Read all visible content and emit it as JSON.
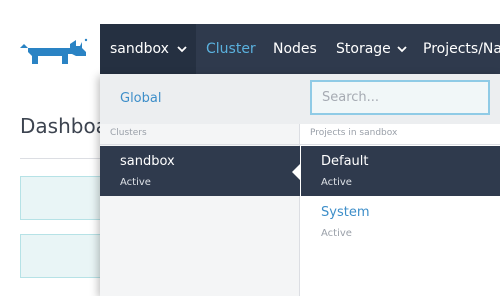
{
  "header": {
    "cluster_label": "sandbox",
    "nav": [
      {
        "label": "Cluster"
      },
      {
        "label": "Nodes"
      },
      {
        "label": "Storage"
      },
      {
        "label": "Projects/Nam"
      }
    ]
  },
  "page": {
    "title": "Dashboa"
  },
  "dropdown": {
    "global_label": "Global",
    "search_placeholder": "Search...",
    "clusters_heading": "Clusters",
    "projects_heading": "Projects in sandbox",
    "clusters": [
      {
        "name": "sandbox",
        "state": "Active",
        "selected": true
      }
    ],
    "projects": [
      {
        "name": "Default",
        "state": "Active",
        "selected": true
      },
      {
        "name": "System",
        "state": "Active",
        "selected": false
      }
    ]
  },
  "colors": {
    "header_bg": "#2f3a4d",
    "accent": "#3d8ec9",
    "logo": "#2a83c4"
  }
}
